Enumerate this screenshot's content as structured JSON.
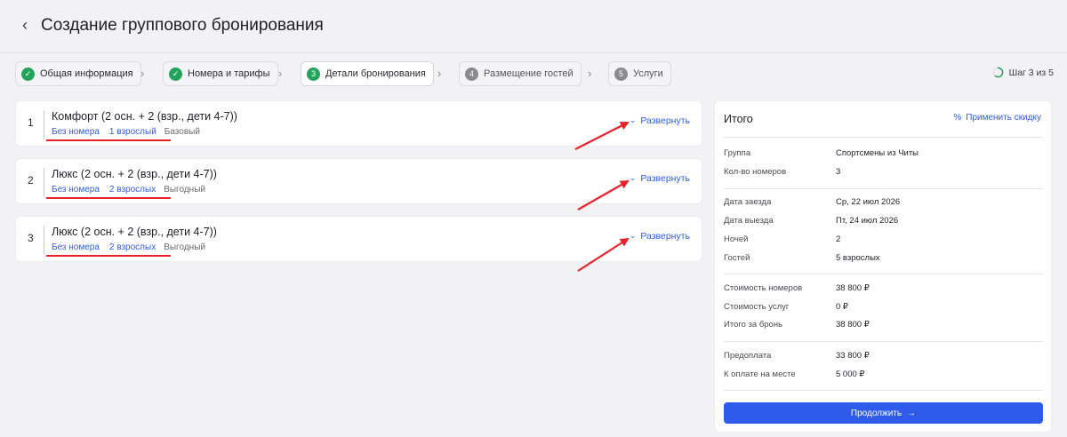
{
  "header": {
    "title": "Создание группового бронирования",
    "back_icon": "chevron-left-icon"
  },
  "stepper": {
    "steps": [
      {
        "badge": "✓",
        "label": "Общая информация",
        "state": "done"
      },
      {
        "badge": "✓",
        "label": "Номера и тарифы",
        "state": "done"
      },
      {
        "badge": "3",
        "label": "Детали бронирования",
        "state": "current"
      },
      {
        "badge": "4",
        "label": "Размещение гостей",
        "state": "pending"
      },
      {
        "badge": "5",
        "label": "Услуги",
        "state": "pending"
      }
    ],
    "separator": "›",
    "counter": "Шаг 3 из 5",
    "progress": 0.6
  },
  "rooms": [
    {
      "num": "1",
      "name": "Комфорт (2 осн. + 2 (взр., дети 4-7))",
      "room_status": "Без номера",
      "guests": "1 взрослый",
      "tariff": "Базовый",
      "expand_label": "Развернуть"
    },
    {
      "num": "2",
      "name": "Люкс (2 осн. + 2 (взр., дети 4-7))",
      "room_status": "Без номера",
      "guests": "2 взрослых",
      "tariff": "Выгодный",
      "expand_label": "Развернуть"
    },
    {
      "num": "3",
      "name": "Люкс (2 осн. + 2 (взр., дети 4-7))",
      "room_status": "Без номера",
      "guests": "2 взрослых",
      "tariff": "Выгодный",
      "expand_label": "Развернуть"
    }
  ],
  "summary": {
    "title": "Итого",
    "discount_label": "Применить скидку",
    "group_label": "Группа",
    "group_value": "Спортсмены из Читы",
    "rooms_count_label": "Кол-во номеров",
    "rooms_count_value": "3",
    "checkin_label": "Дата заезда",
    "checkin_value": "Ср, 22 июл 2026",
    "checkout_label": "Дата выезда",
    "checkout_value": "Пт, 24 июл 2026",
    "nights_label": "Ночей",
    "nights_value": "2",
    "guests_label": "Гостей",
    "guests_value": "5 взрослых",
    "rooms_cost_label": "Стоимость номеров",
    "rooms_cost_value": "38 800 ₽",
    "services_cost_label": "Стоимость услуг",
    "services_cost_value": "0 ₽",
    "total_label": "Итого за бронь",
    "total_value": "38 800 ₽",
    "prepay_label": "Предоплата",
    "prepay_value": "33 800 ₽",
    "onsite_label": "К оплате на месте",
    "onsite_value": "5 000 ₽",
    "continue_label": "Продолжить"
  },
  "colors": {
    "accent": "#2f5bea",
    "success": "#22a45d",
    "annotation": "#e8222b"
  }
}
